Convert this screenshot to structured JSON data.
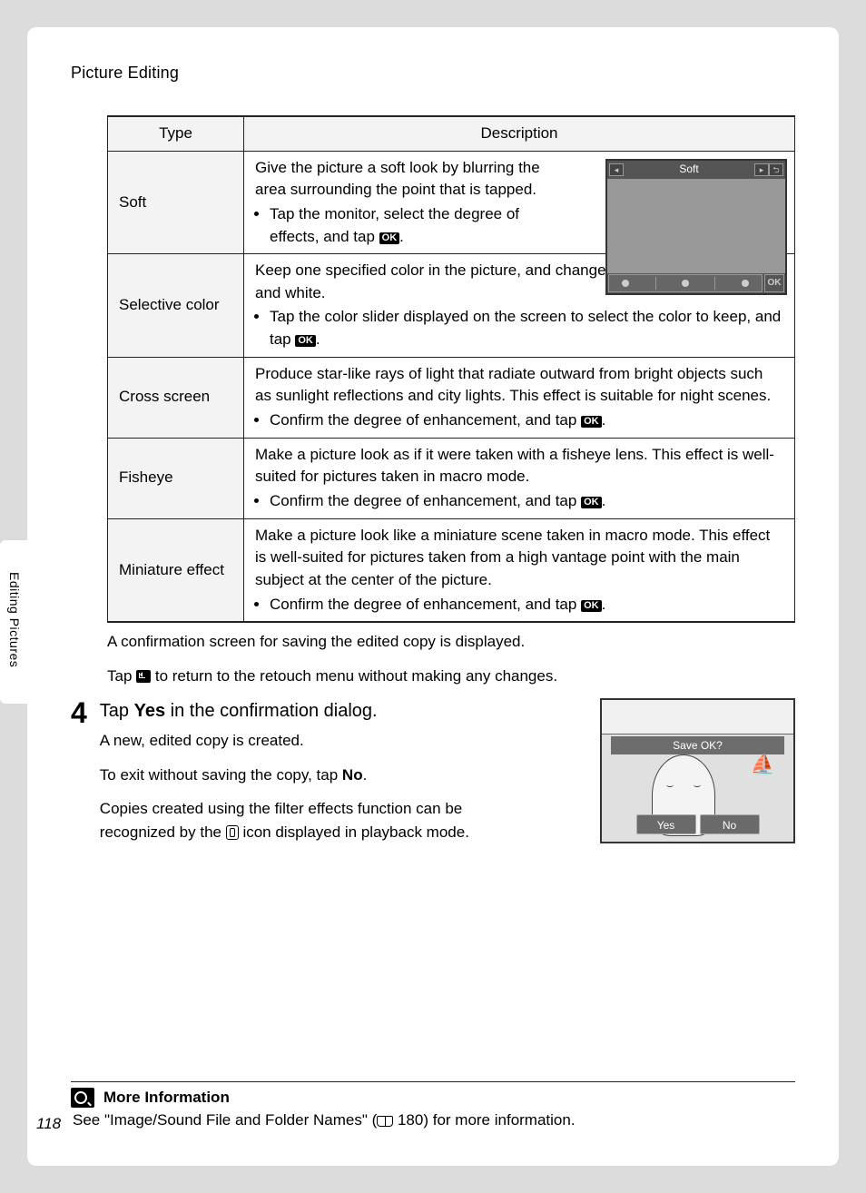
{
  "header": "Picture Editing",
  "side_label": "Editing Pictures",
  "page_number": "118",
  "table": {
    "head_type": "Type",
    "head_desc": "Description",
    "rows": [
      {
        "type": "Soft",
        "desc_intro": "Give the picture a soft look by blurring the area surrounding the point that is tapped.",
        "bullet": "Tap the monitor, select the degree of effects, and tap ",
        "bullet_end": ".",
        "mini_title": "Soft",
        "ok_label": "OK"
      },
      {
        "type": "Selective color",
        "desc_intro": "Keep one specified color in the picture, and change the other colors to black and white.",
        "bullet": "Tap the color slider displayed on the screen to select the color to keep, and tap ",
        "bullet_end": "."
      },
      {
        "type": "Cross screen",
        "desc_intro": "Produce star-like rays of light that radiate outward from bright objects such as sunlight reflections and city lights. This effect is suitable for night scenes.",
        "bullet": "Confirm the degree of enhancement, and tap ",
        "bullet_end": "."
      },
      {
        "type": "Fisheye",
        "desc_intro": "Make a picture look as if it were taken with a fisheye lens. This effect is well-suited for pictures taken in macro mode.",
        "bullet": "Confirm the degree of enhancement, and tap ",
        "bullet_end": "."
      },
      {
        "type": "Miniature effect",
        "desc_intro": "Make a picture look like a miniature scene taken in macro mode. This effect is well-suited for pictures taken from a high vantage point with the main subject at the center of the picture.",
        "bullet": "Confirm the degree of enhancement, and tap ",
        "bullet_end": "."
      }
    ]
  },
  "after_table_1": "A confirmation screen for saving the edited copy is displayed.",
  "after_table_2a": "Tap ",
  "after_table_2b": " to return to the retouch menu without making any changes.",
  "step4": {
    "num": "4",
    "title_a": "Tap ",
    "title_yes": "Yes",
    "title_b": " in the confirmation dialog.",
    "p1": "A new, edited copy is created.",
    "p2a": "To exit without saving the copy, tap ",
    "p2_no": "No",
    "p2b": ".",
    "p3a": "Copies created using the filter effects function can be recognized by the ",
    "p3b": " icon displayed in playback mode.",
    "save_prompt": "Save OK?",
    "yes_btn": "Yes",
    "no_btn": "No"
  },
  "more_info": {
    "title": "More Information",
    "text_a": "See \"Image/Sound File and Folder Names\" (",
    "page_ref": " 180) for more information."
  }
}
